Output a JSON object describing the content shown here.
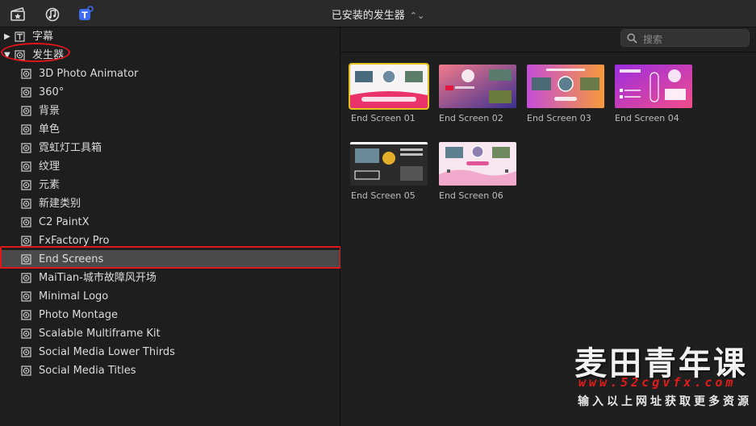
{
  "header": {
    "title": "已安装的发生器",
    "title_chevron": "⌃⌄",
    "icons": [
      "clapper-star-icon",
      "music-note-icon",
      "titles-generators-icon"
    ]
  },
  "sidebar": {
    "top_items": [
      {
        "label": "字幕",
        "expanded": false
      },
      {
        "label": "发生器",
        "expanded": true
      }
    ],
    "children": [
      "3D Photo Animator",
      "360°",
      "背景",
      "单色",
      "霓虹灯工具箱",
      "纹理",
      "元素",
      "新建类别",
      "C2 PaintX",
      "FxFactory Pro",
      "End Screens",
      "MaiTian-城市故障风开场",
      "Minimal Logo",
      "Photo Montage",
      "Scalable Multiframe Kit",
      "Social Media Lower Thirds",
      "Social Media Titles"
    ],
    "selected": "End Screens"
  },
  "search": {
    "placeholder": "搜索"
  },
  "thumbnails": [
    {
      "label": "End Screen 01",
      "selected": true
    },
    {
      "label": "End Screen 02",
      "selected": false
    },
    {
      "label": "End Screen 03",
      "selected": false
    },
    {
      "label": "End Screen 04",
      "selected": false
    },
    {
      "label": "End Screen 05",
      "selected": false
    },
    {
      "label": "End Screen 06",
      "selected": false
    }
  ],
  "watermark": {
    "brand": "麦田青年课",
    "url": "www.52cgvfx.com",
    "slogan": "输入以上网址获取更多资源"
  },
  "colors": {
    "annotation_red": "#e0161b",
    "selection_yellow": "#e7c41d",
    "accent_blue": "#3d6cf0"
  }
}
